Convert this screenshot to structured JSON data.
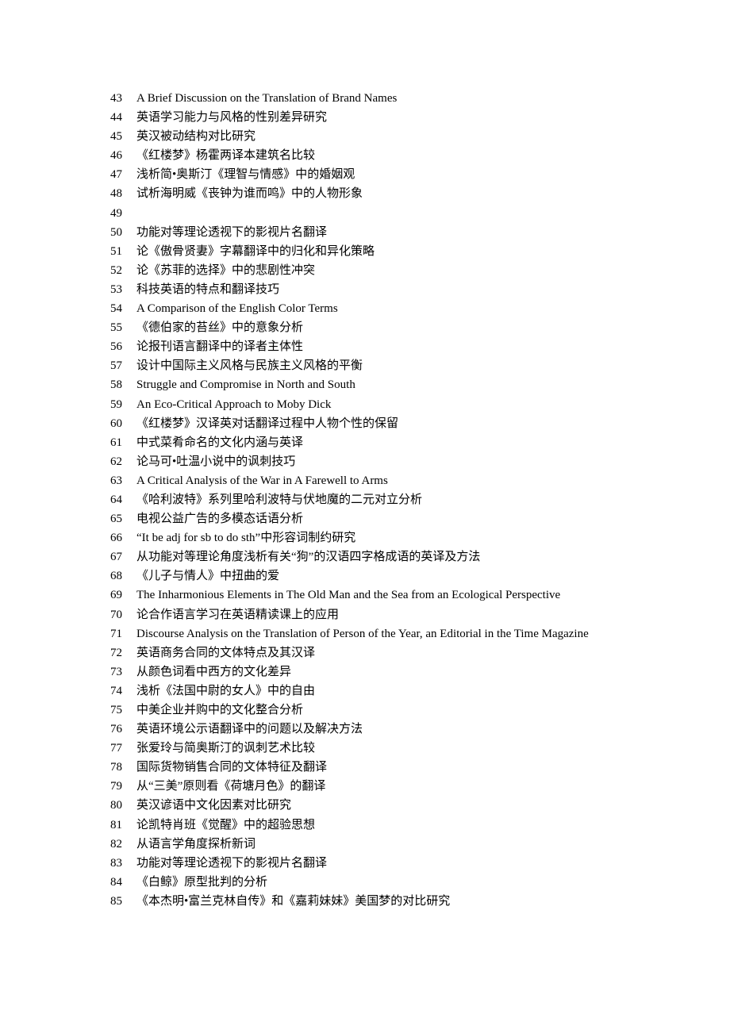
{
  "document": {
    "items": [
      {
        "num": "43",
        "text": "A Brief Discussion on the Translation of Brand Names"
      },
      {
        "num": "44",
        "text": "英语学习能力与风格的性别差异研究"
      },
      {
        "num": "45",
        "text": "英汉被动结构对比研究"
      },
      {
        "num": "46",
        "text": "《红楼梦》杨霍两译本建筑名比较"
      },
      {
        "num": "47",
        "text": "浅析简•奥斯汀《理智与情感》中的婚姻观"
      },
      {
        "num": "48",
        "text": "试析海明威《丧钟为谁而鸣》中的人物形象"
      },
      {
        "num": "49",
        "text": ""
      },
      {
        "num": "50",
        "text": "功能对等理论透视下的影视片名翻译"
      },
      {
        "num": "51",
        "text": "论《傲骨贤妻》字幕翻译中的归化和异化策略"
      },
      {
        "num": "52",
        "text": "论《苏菲的选择》中的悲剧性冲突"
      },
      {
        "num": "53",
        "text": "科技英语的特点和翻译技巧"
      },
      {
        "num": "54",
        "text": "A Comparison of the English Color Terms"
      },
      {
        "num": "55",
        "text": "《德伯家的苔丝》中的意象分析"
      },
      {
        "num": "56",
        "text": "论报刊语言翻译中的译者主体性"
      },
      {
        "num": "57",
        "text": "设计中国际主义风格与民族主义风格的平衡"
      },
      {
        "num": "58",
        "text": "Struggle and Compromise in North and South"
      },
      {
        "num": "59",
        "text": "An Eco-Critical Approach to Moby Dick"
      },
      {
        "num": "60",
        "text": "《红楼梦》汉译英对话翻译过程中人物个性的保留"
      },
      {
        "num": "61",
        "text": "中式菜肴命名的文化内涵与英译"
      },
      {
        "num": "62",
        "text": "论马可•吐温小说中的讽刺技巧"
      },
      {
        "num": "63",
        "text": "A Critical Analysis of the War in A Farewell to Arms"
      },
      {
        "num": "64",
        "text": "《哈利波特》系列里哈利波特与伏地魔的二元对立分析"
      },
      {
        "num": "65",
        "text": "电视公益广告的多模态话语分析"
      },
      {
        "num": "66",
        "text": "“It be adj for sb to do sth”中形容词制约研究"
      },
      {
        "num": "67",
        "text": "从功能对等理论角度浅析有关“狗”的汉语四字格成语的英译及方法"
      },
      {
        "num": "68",
        "text": "《儿子与情人》中扭曲的爱"
      },
      {
        "num": "69",
        "text": "The Inharmonious Elements in The Old Man and the Sea from an Ecological Perspective"
      },
      {
        "num": "70",
        "text": "论合作语言学习在英语精读课上的应用"
      },
      {
        "num": "71",
        "text": "Discourse Analysis on the Translation of Person of the Year, an Editorial in the Time Magazine"
      },
      {
        "num": "72",
        "text": "英语商务合同的文体特点及其汉译"
      },
      {
        "num": "73",
        "text": "从颜色词看中西方的文化差异"
      },
      {
        "num": "74",
        "text": "浅析《法国中尉的女人》中的自由"
      },
      {
        "num": "75",
        "text": "中美企业并购中的文化整合分析"
      },
      {
        "num": "76",
        "text": "英语环境公示语翻译中的问题以及解决方法"
      },
      {
        "num": "77",
        "text": "张爱玲与简奥斯汀的讽刺艺术比较"
      },
      {
        "num": "78",
        "text": "国际货物销售合同的文体特征及翻译"
      },
      {
        "num": "79",
        "text": "从“三美”原则看《荷塘月色》的翻译"
      },
      {
        "num": "80",
        "text": "英汉谚语中文化因素对比研究"
      },
      {
        "num": "81",
        "text": "论凯特肖班《觉醒》中的超验思想"
      },
      {
        "num": "82",
        "text": "从语言学角度探析新词"
      },
      {
        "num": "83",
        "text": "功能对等理论透视下的影视片名翻译"
      },
      {
        "num": "84",
        "text": "《白鲸》原型批判的分析"
      },
      {
        "num": "85",
        "text": "《本杰明•富兰克林自传》和《嘉莉妹妹》美国梦的对比研究"
      }
    ]
  }
}
